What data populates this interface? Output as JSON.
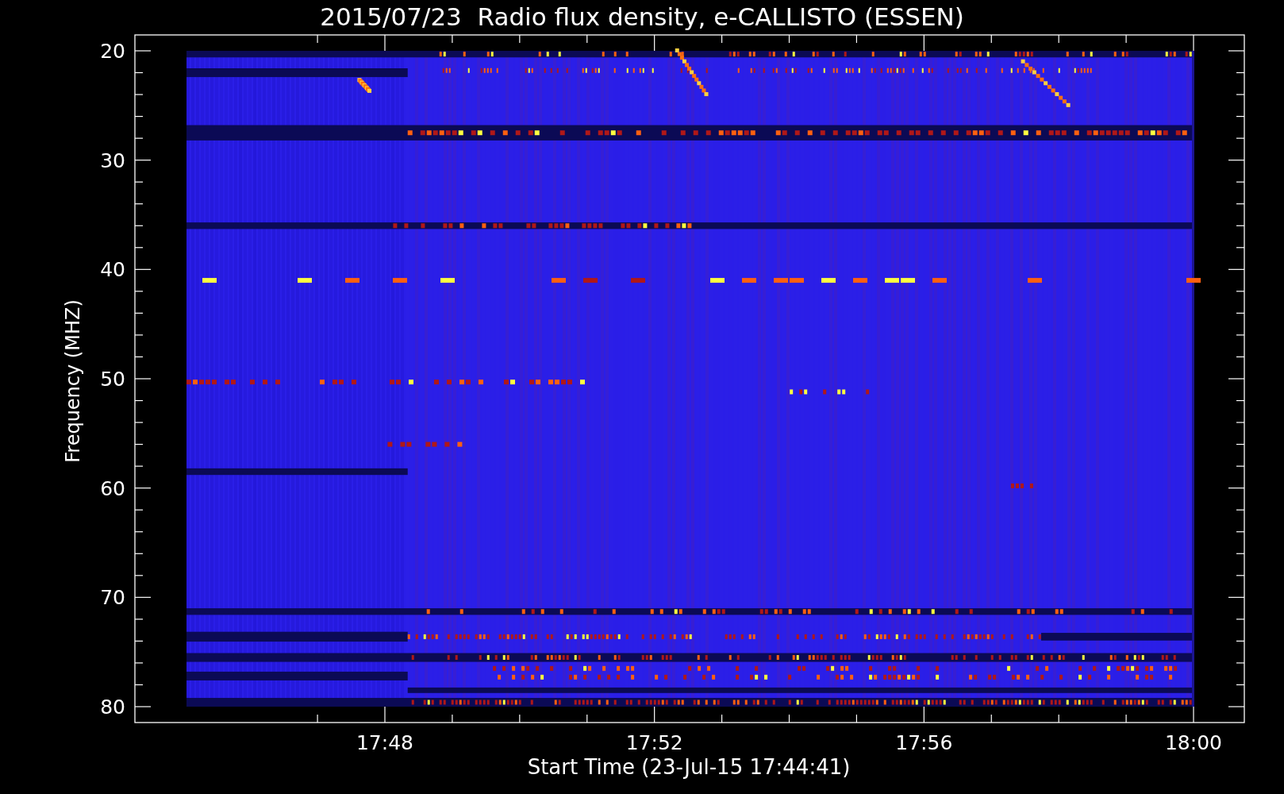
{
  "title": "2015/07/23  Radio flux density, e-CALLISTO (ESSEN)",
  "y_axis": {
    "label": "Frequency (MHZ)",
    "ticks": [
      "20",
      "30",
      "40",
      "50",
      "60",
      "70",
      "80"
    ]
  },
  "x_axis": {
    "label": "Start Time (23-Jul-15 17:44:41)",
    "ticks": [
      "17:48",
      "17:52",
      "17:56",
      "18:00"
    ]
  }
}
